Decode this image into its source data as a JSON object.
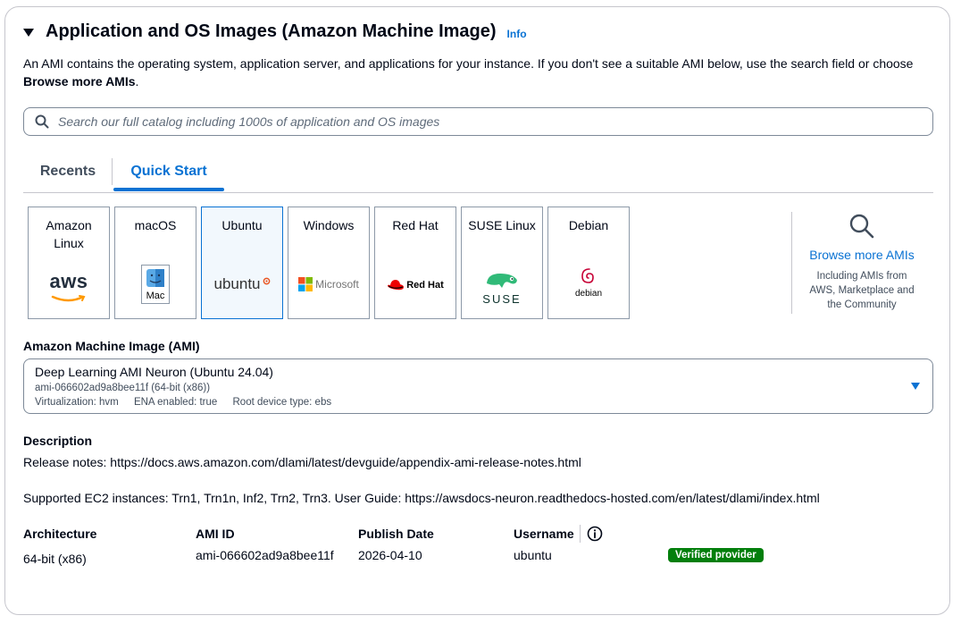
{
  "header": {
    "title": "Application and OS Images (Amazon Machine Image)",
    "info_label": "Info"
  },
  "description": {
    "text": "An AMI contains the operating system, application server, and applications for your instance. If you don't see a suitable AMI below, use the search field or choose",
    "bold": "Browse more AMIs",
    "end": "."
  },
  "search": {
    "placeholder": "Search our full catalog including 1000s of application and OS images",
    "icon": "search-icon"
  },
  "tabs": [
    {
      "label": "Recents"
    },
    {
      "label": "Quick Start"
    }
  ],
  "os_cards": [
    {
      "label_line1": "Amazon",
      "label_line2": "Linux",
      "logo_text": "aws"
    },
    {
      "label_line1": "macOS",
      "logo_text": "Mac"
    },
    {
      "label_line1": "Ubuntu",
      "logo_text": "ubuntu",
      "selected": true
    },
    {
      "label_line1": "Windows",
      "logo_text": "Microsoft"
    },
    {
      "label_line1": "Red Hat",
      "logo_text": "Red Hat"
    },
    {
      "label_line1": "SUSE Linux",
      "logo_text": "SUSE"
    },
    {
      "label_line1": "Debian",
      "logo_text": "debian"
    }
  ],
  "browse": {
    "link": "Browse more AMIs",
    "sub1": "Including AMIs from",
    "sub2": "AWS, Marketplace and",
    "sub3": "the Community"
  },
  "ami": {
    "label": "Amazon Machine Image (AMI)",
    "name": "Deep Learning AMI Neuron (Ubuntu 24.04)",
    "id_line": "ami-066602ad9a8bee11f (64-bit (x86))",
    "virtualization": "Virtualization: hvm",
    "ena": "ENA enabled: true",
    "root": "Root device type: ebs"
  },
  "details": {
    "description_label": "Description",
    "release_notes": "Release notes: https://docs.aws.amazon.com/dlami/latest/devguide/appendix-ami-release-notes.html",
    "supported": "Supported EC2 instances: Trn1, Trn1n, Inf2, Trn2, Trn3. User Guide: https://awsdocs-neuron.readthedocs-hosted.com/en/latest/dlami/index.html",
    "architecture_label": "Architecture",
    "architecture_value": "64-bit (x86)",
    "ami_id_label": "AMI ID",
    "ami_id_value": "ami-066602ad9a8bee11f",
    "publish_date_label": "Publish Date",
    "publish_date_value": "2026-04-10",
    "username_label": "Username",
    "username_value": "ubuntu",
    "badge": "Verified provider"
  },
  "colors": {
    "accent": "#0972d3",
    "verified": "#037f0c",
    "border": "#c6c6cd"
  }
}
